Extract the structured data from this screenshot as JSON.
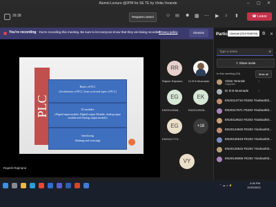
{
  "window": {
    "title": "Alumni Lecture @2PM for SE TE by Vinita Yerande",
    "controls": [
      "–",
      "▢",
      "✕"
    ]
  },
  "toolbar": {
    "timer": "26:38",
    "request_control": "Request control",
    "leave_label": "Leave",
    "icons": [
      "people-icon",
      "chat-icon",
      "reactions-icon",
      "rooms-icon",
      "more-icon",
      "camera-icon",
      "mic-icon",
      "share-icon"
    ]
  },
  "recording_banner": {
    "title": "You're recording",
    "message": "You're recording this meeting. Be sure to let everyone know that they are being recorded.",
    "link": "Privacy policy",
    "dismiss": "Dismiss"
  },
  "slide": {
    "vertical_title": "PLC",
    "boxes": [
      {
        "text1": "Basics of PLC",
        "text2": "(Architecture of PLC, Scan cycle and types of PLC)"
      },
      {
        "text1": "IO modules",
        "text2": "(Digital input module, Digital output Module, Analog input module and Analog output module)"
      },
      {
        "text1": "Interfacing",
        "text2": "(Sinking and sourcing)"
      }
    ]
  },
  "presenter_label": "Rajesh Rajmane",
  "tiles": [
    {
      "initials": "RR",
      "name": "Rajesh Rajmane",
      "color": "#e7d0cc"
    },
    {
      "initials": "",
      "name": "Dr B B Musmade",
      "color": "#ffffff"
    },
    {
      "initials": "EG",
      "name": "EN20113568...",
      "color": "#d6e7d6"
    },
    {
      "initials": "EK",
      "name": "EN20113528...",
      "color": "#d6e7d6"
    },
    {
      "initials": "EG",
      "name": "EN20117?79...",
      "color": "#eadfc8"
    },
    {
      "initials": "+18",
      "name": "",
      "color": "#3b3b3b"
    }
  ],
  "bottom_tile": {
    "initials": "VY",
    "color": "#eadfc8"
  },
  "participants_panel": {
    "title": "Partic",
    "unmute_tip": "Unmute (Ctrl+Shift+M)",
    "search_placeholder": "Type a name",
    "share_invite": "Share invite",
    "in_meeting": "In this meeting (24)",
    "mute_all": "Mute all",
    "people": [
      {
        "name": "Vinita Yerande",
        "sub": "Organizer",
        "color": "#b89a7a"
      },
      {
        "name": "Dr B B Musmade",
        "sub": "",
        "color": "#aab0b8"
      },
      {
        "name": "EN20113710 FE202 Yinahaol03...",
        "sub": "",
        "color": "#c08e74"
      },
      {
        "name": "EN20117571 FE202 Yinahaol03...",
        "sub": "",
        "color": "#a884b8"
      },
      {
        "name": "EN20119622 FE202 Yinahaol03...",
        "sub": "",
        "color": "#c9a27a"
      },
      {
        "name": "EN20124940 FE202 Yinahaol03...",
        "sub": "",
        "color": "#c08e74"
      },
      {
        "name": "EN20125519 FE202 Yinahaol03...",
        "sub": "",
        "color": "#7a8fc0"
      },
      {
        "name": "EN20125522 FE202 Yinahaol03...",
        "sub": "",
        "color": "#b8a07a"
      },
      {
        "name": "EN20146066 FE202 Yinahaol03...",
        "sub": "",
        "color": "#a884b8"
      }
    ]
  },
  "taskbar": {
    "time": "2:06 PM",
    "date": "11/30/2022",
    "apps": [
      {
        "name": "start-icon",
        "color": "#3c8fe6"
      },
      {
        "name": "search-icon",
        "color": "#8a8a8a"
      },
      {
        "name": "explorer-icon",
        "color": "#e8b84a"
      },
      {
        "name": "edge-icon",
        "color": "#2aa0d8"
      },
      {
        "name": "chrome-icon",
        "color": "#e24a3a"
      },
      {
        "name": "mail-icon",
        "color": "#2b6fcf"
      },
      {
        "name": "teams-icon",
        "color": "#5a5fc9"
      },
      {
        "name": "word-icon",
        "color": "#2b5fb3"
      },
      {
        "name": "powerpoint-icon",
        "color": "#d24726"
      },
      {
        "name": "store-icon",
        "color": "#3b7cd8"
      }
    ]
  }
}
